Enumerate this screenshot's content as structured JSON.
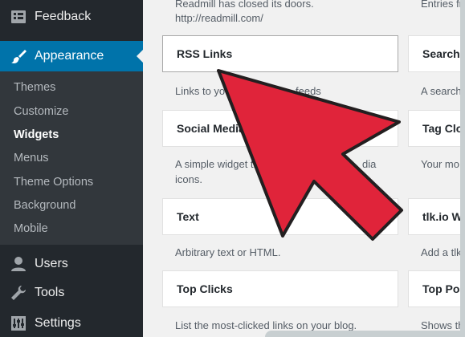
{
  "sidebar": {
    "feedback": "Feedback",
    "appearance": "Appearance",
    "submenu": [
      "Themes",
      "Customize",
      "Widgets",
      "Menus",
      "Theme Options",
      "Background",
      "Mobile"
    ],
    "users": "Users",
    "tools": "Tools",
    "settings": "Settings",
    "accent_color": "#0073aa"
  },
  "widgets_left": {
    "top_desc_line1": "Readmill has closed its doors.",
    "top_desc_line2": "http://readmill.com/",
    "rss_title": "RSS Links",
    "rss_desc": "Links to yo",
    "rss_desc_tail": "feeds",
    "social_title": "Social Media",
    "social_desc_line1": "A simple widget th",
    "social_desc_tail": "dia",
    "social_desc_line2": "icons.",
    "text_title": "Text",
    "text_desc": "Arbitrary text or HTML.",
    "topclicks_title": "Top Clicks",
    "topclicks_desc": "List the most-clicked links on your blog."
  },
  "widgets_right": {
    "top_desc": "Entries fr",
    "search_title": "Search",
    "search_desc": "A search",
    "tagcloud_title": "Tag Clo",
    "tagcloud_desc": "Your mo",
    "tlkio_title": "tlk.io W",
    "tlkio_desc": "Add a tlk",
    "toppos_title": "Top Po",
    "toppos_desc": "Shows th"
  },
  "overlay": {
    "arrow_color": "#e0243a",
    "arrow_icon": "pointer-arrow-icon"
  }
}
